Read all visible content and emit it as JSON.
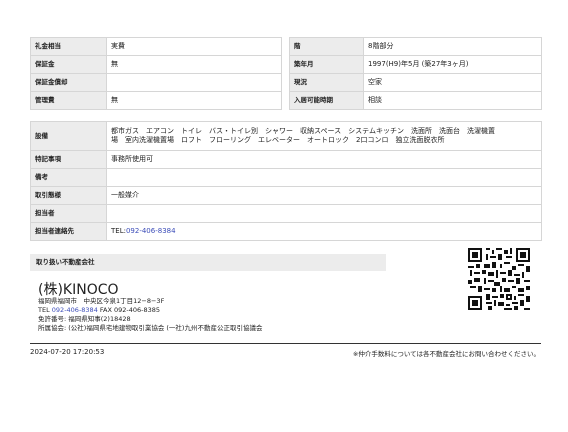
{
  "top_table": [
    {
      "label_left": "礼金相当",
      "value_left": "実費",
      "label_right": "階",
      "value_right": "8階部分"
    },
    {
      "label_left": "保証金",
      "value_left": "無",
      "label_right": "築年月",
      "value_right": "1997(H9)年5月 (築27年3ヶ月)"
    },
    {
      "label_left": "保証金償却",
      "value_left": "",
      "label_right": "現況",
      "value_right": "空家"
    },
    {
      "label_left": "管理費",
      "value_left": "無",
      "label_right": "入居可能時期",
      "value_right": "相談"
    }
  ],
  "facilities": {
    "label": "設備",
    "line1": "都市ガス　エアコン　トイレ　バス・トイレ別　シャワー　収納スペース　システムキッチン　洗面所　洗面台　洗濯機置",
    "line2": "場　室内洗濯機置場　ロフト　フローリング　エレベーター　オートロック　2口コンロ　独立洗面脱衣所"
  },
  "details": [
    {
      "label": "特記事項",
      "value": "事務所使用可"
    },
    {
      "label": "備考",
      "value": ""
    },
    {
      "label": "取引態様",
      "value": "一般媒介"
    },
    {
      "label": "担当者",
      "value": ""
    },
    {
      "label": "担当者連絡先",
      "prefix": "TEL:",
      "value": "092-406-8384"
    }
  ],
  "agent": {
    "heading": "取り扱い不動産会社",
    "name": "(株)KINOCO",
    "address": "福岡県福岡市　中央区今泉1丁目12−8−3F",
    "tel_label": "TEL",
    "tel": "092-406-8384",
    "fax": "FAX 092-406-8385",
    "license": "免許番号: 福岡県知事(2)18428",
    "association": "所属協会: (公社)福岡県宅地建物取引業協会 (一社)九州不動産公正取引協議会"
  },
  "footer": {
    "timestamp": "2024-07-20 17:20:53",
    "note": "※仲介手数料については各不動産会社にお問い合わせください。"
  }
}
